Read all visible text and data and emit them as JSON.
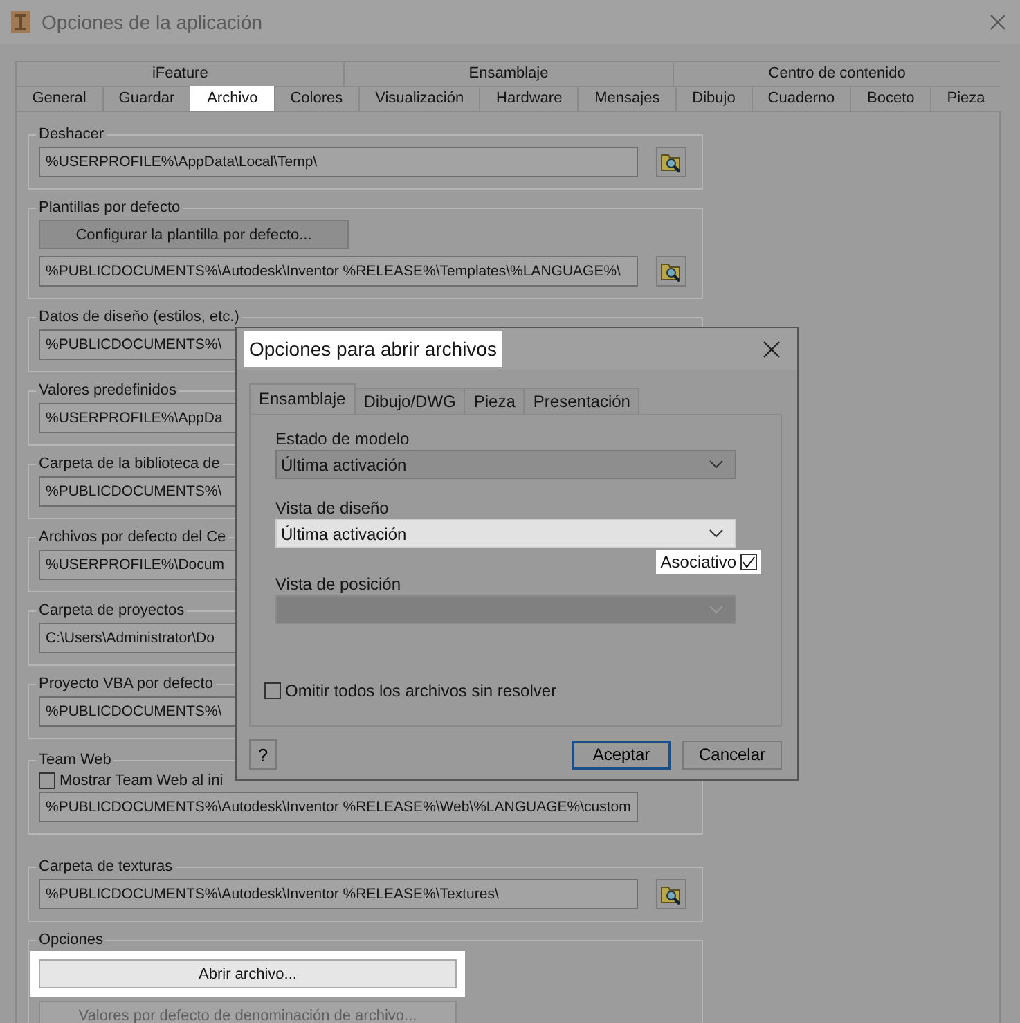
{
  "window": {
    "title": "Opciones de la aplicación"
  },
  "tabs": {
    "upper": [
      {
        "label": "iFeature"
      },
      {
        "label": "Ensamblaje"
      },
      {
        "label": "Centro de contenido"
      }
    ],
    "lower": [
      {
        "label": "General",
        "selected": false
      },
      {
        "label": "Guardar",
        "selected": false
      },
      {
        "label": "Archivo",
        "selected": true
      },
      {
        "label": "Colores",
        "selected": false
      },
      {
        "label": "Visualización",
        "selected": false
      },
      {
        "label": "Hardware",
        "selected": false
      },
      {
        "label": "Mensajes",
        "selected": false
      },
      {
        "label": "Dibujo",
        "selected": false
      },
      {
        "label": "Cuaderno",
        "selected": false
      },
      {
        "label": "Boceto",
        "selected": false
      },
      {
        "label": "Pieza",
        "selected": false
      }
    ]
  },
  "groups": [
    {
      "kind": "path",
      "label": "Deshacer",
      "value": "%USERPROFILE%\\AppData\\Local\\Temp\\",
      "browse": true
    },
    {
      "kind": "template",
      "label": "Plantillas por defecto",
      "button": "Configurar la plantilla por defecto...",
      "value": "%PUBLICDOCUMENTS%\\Autodesk\\Inventor %RELEASE%\\Templates\\%LANGUAGE%\\",
      "browse": true
    },
    {
      "kind": "path",
      "label": "Datos de diseño (estilos, etc.)",
      "value": "%PUBLICDOCUMENTS%\\"
    },
    {
      "kind": "path",
      "label": "Valores predefinidos",
      "value": "%USERPROFILE%\\AppDa"
    },
    {
      "kind": "path",
      "label": "Carpeta de la biblioteca de",
      "value": "%PUBLICDOCUMENTS%\\"
    },
    {
      "kind": "path",
      "label": "Archivos por defecto del Ce",
      "value": "%USERPROFILE%\\Docum"
    },
    {
      "kind": "path",
      "label": "Carpeta de proyectos",
      "value": "C:\\Users\\Administrator\\Do"
    },
    {
      "kind": "path",
      "label": "Proyecto VBA por defecto",
      "value": "%PUBLICDOCUMENTS%\\"
    },
    {
      "kind": "checkbox_path",
      "label": "Team Web",
      "checkbox": {
        "label": "Mostrar Team Web al ini",
        "checked": false
      },
      "value": "%PUBLICDOCUMENTS%\\Autodesk\\Inventor %RELEASE%\\Web\\%LANGUAGE%\\custom"
    },
    {
      "kind": "path",
      "label": "Carpeta de texturas",
      "value": "%PUBLICDOCUMENTS%\\Autodesk\\Inventor %RELEASE%\\Textures\\",
      "browse": true
    },
    {
      "kind": "buttons",
      "label": "Opciones",
      "buttons": [
        {
          "label": "Abrir archivo...",
          "highlighted": true,
          "disabled": false
        },
        {
          "label": "Valores por defecto de denominación de archivo...",
          "highlighted": false,
          "disabled": true
        }
      ]
    }
  ],
  "dialog": {
    "title": "Opciones para abrir archivos",
    "title_highlighted": true,
    "tabs": [
      {
        "label": "Ensamblaje",
        "selected": true
      },
      {
        "label": "Dibujo/DWG",
        "selected": false
      },
      {
        "label": "Pieza",
        "selected": false
      },
      {
        "label": "Presentación",
        "selected": false
      }
    ],
    "fields": [
      {
        "label": "Estado de modelo",
        "value": "Última activación",
        "disabled": false,
        "highlighted": false
      },
      {
        "label": "Vista de diseño",
        "value": "Última activación",
        "disabled": false,
        "highlighted": true
      },
      {
        "label": "Vista de posición",
        "disabled": true,
        "highlighted": false
      }
    ],
    "associative": {
      "label": "Asociativo",
      "checked": true,
      "highlighted": true
    },
    "skip": {
      "label": "Omitir todos los archivos sin resolver",
      "checked": false
    },
    "help": {
      "label": "?"
    },
    "buttons": [
      {
        "label": "Aceptar",
        "default": true
      },
      {
        "label": "Cancelar",
        "default": false
      }
    ]
  }
}
